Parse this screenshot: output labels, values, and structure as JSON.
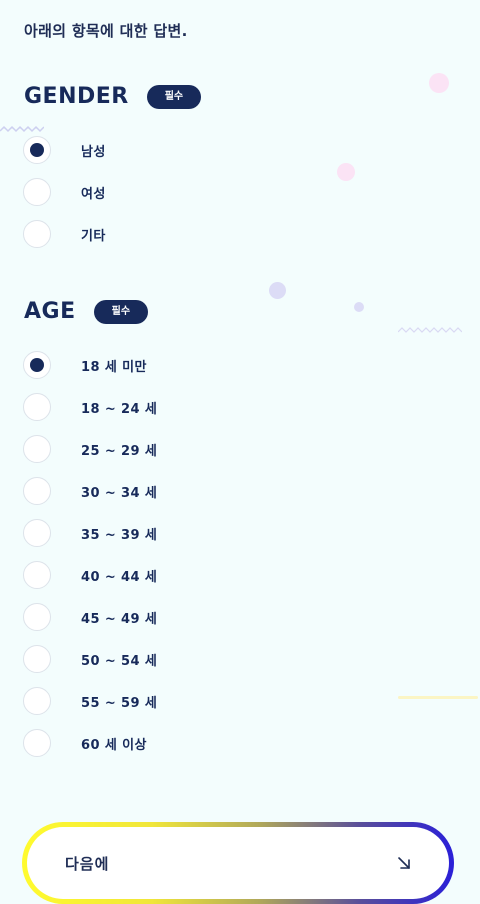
{
  "intro_text": "아래의 항목에 대한 답변.",
  "gender": {
    "title": "GENDER",
    "badge": "필수",
    "options": [
      {
        "label": "남성",
        "selected": true
      },
      {
        "label": "여성",
        "selected": false
      },
      {
        "label": "기타",
        "selected": false
      }
    ]
  },
  "age": {
    "title": "AGE",
    "badge": "필수",
    "options": [
      {
        "label": "18 세 미만",
        "selected": true
      },
      {
        "label": "18 ~ 24 세",
        "selected": false
      },
      {
        "label": "25 ~ 29 세",
        "selected": false
      },
      {
        "label": "30 ~ 34 세",
        "selected": false
      },
      {
        "label": "35 ~ 39 세",
        "selected": false
      },
      {
        "label": "40 ~ 44 세",
        "selected": false
      },
      {
        "label": "45 ~ 49 세",
        "selected": false
      },
      {
        "label": "50 ~ 54 세",
        "selected": false
      },
      {
        "label": "55 ~ 59 세",
        "selected": false
      },
      {
        "label": "60 세 이상",
        "selected": false
      }
    ]
  },
  "next_button": {
    "label": "다음에",
    "icon": "arrow-down-right-icon"
  },
  "colors": {
    "primary": "#172a5a",
    "background": "#f3fdfd",
    "radio_border": "#dde3ea",
    "button_gradient_start": "#fffb2e",
    "button_gradient_end": "#2a1fd8"
  }
}
